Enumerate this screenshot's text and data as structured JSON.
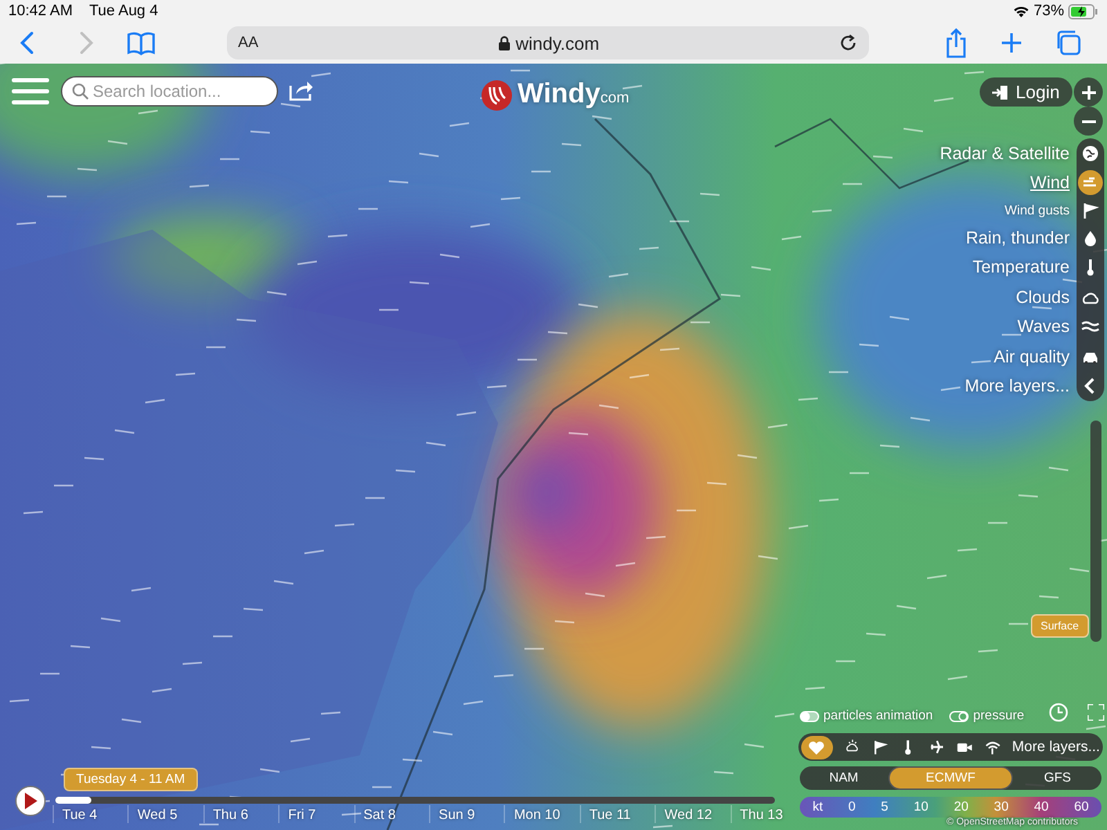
{
  "status_bar": {
    "time": "10:42 AM",
    "date": "Tue Aug 4",
    "battery": "73%"
  },
  "browser": {
    "text_size": "AA",
    "url": "windy.com"
  },
  "search": {
    "placeholder": "Search location..."
  },
  "logo": {
    "name": "Windy",
    "suffix": "com"
  },
  "login": "Login",
  "layers": [
    {
      "label": "Radar & Satellite",
      "kind": "main",
      "selected": false
    },
    {
      "label": "Wind",
      "kind": "main",
      "selected": true
    },
    {
      "label": "Wind gusts",
      "kind": "sub",
      "selected": false
    },
    {
      "label": "Rain, thunder",
      "kind": "main",
      "selected": false
    },
    {
      "label": "Temperature",
      "kind": "main",
      "selected": false
    },
    {
      "label": "Clouds",
      "kind": "main",
      "selected": false
    },
    {
      "label": "Waves",
      "kind": "main",
      "selected": false
    },
    {
      "label": "Air quality",
      "kind": "main",
      "selected": false
    },
    {
      "label": "More layers...",
      "kind": "main",
      "selected": false
    }
  ],
  "altitude": {
    "label": "Surface"
  },
  "toggles": [
    {
      "label": "particles animation",
      "on": true
    },
    {
      "label": "pressure",
      "on": false
    }
  ],
  "favorites": {
    "more": "More layers..."
  },
  "models": [
    {
      "label": "NAM",
      "selected": false
    },
    {
      "label": "ECMWF",
      "selected": true
    },
    {
      "label": "GFS",
      "selected": false
    }
  ],
  "legend": {
    "unit": "kt",
    "values": [
      "0",
      "5",
      "10",
      "20",
      "30",
      "40",
      "60"
    ]
  },
  "attribution": "© OpenStreetMap contributors",
  "timeline": {
    "tooltip": "Tuesday 4 - 11 AM",
    "level": 0.05,
    "days": [
      "Tue 4",
      "Wed 5",
      "Thu 6",
      "Fri 7",
      "Sat 8",
      "Sun 9",
      "Mon 10",
      "Tue 11",
      "Wed 12",
      "Thu 13"
    ]
  }
}
